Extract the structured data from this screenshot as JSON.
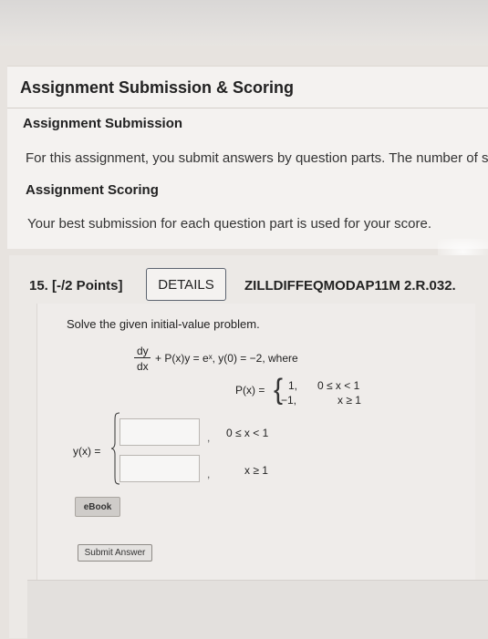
{
  "scoring": {
    "title": "Assignment Submission & Scoring",
    "submission_heading": "Assignment Submission",
    "submission_text": "For this assignment, you submit answers by question parts. The number of su",
    "scoring_heading": "Assignment Scoring",
    "scoring_text": "Your best submission for each question part is used for your score."
  },
  "question": {
    "number_points": "15. [-/2 Points]",
    "details_label": "DETAILS",
    "code": "ZILLDIFFEQMODAP11M 2.R.032.",
    "prompt": "Solve the given initial-value problem.",
    "derivative_num": "dy",
    "derivative_den": "dx",
    "equation_rest": "+ P(x)y = eˣ,  y(0) = −2, where",
    "px_label": "P(x) =",
    "px_value_1": "1,",
    "px_value_2": "−1,",
    "px_cond_1": "0 ≤ x < 1",
    "px_cond_2": "x ≥ 1",
    "yx_label": "y(x) =",
    "answer_1": "",
    "answer_2": "",
    "answer_cond_1": "0 ≤ x < 1",
    "answer_cond_2": "x ≥ 1",
    "separator": ","
  },
  "buttons": {
    "ebook": "eBook",
    "submit": "Submit Answer"
  },
  "colors": {
    "background": "#e7e3df",
    "details_border": "#5d6470"
  },
  "icons": {
    "brace": "left-curly-brace"
  }
}
